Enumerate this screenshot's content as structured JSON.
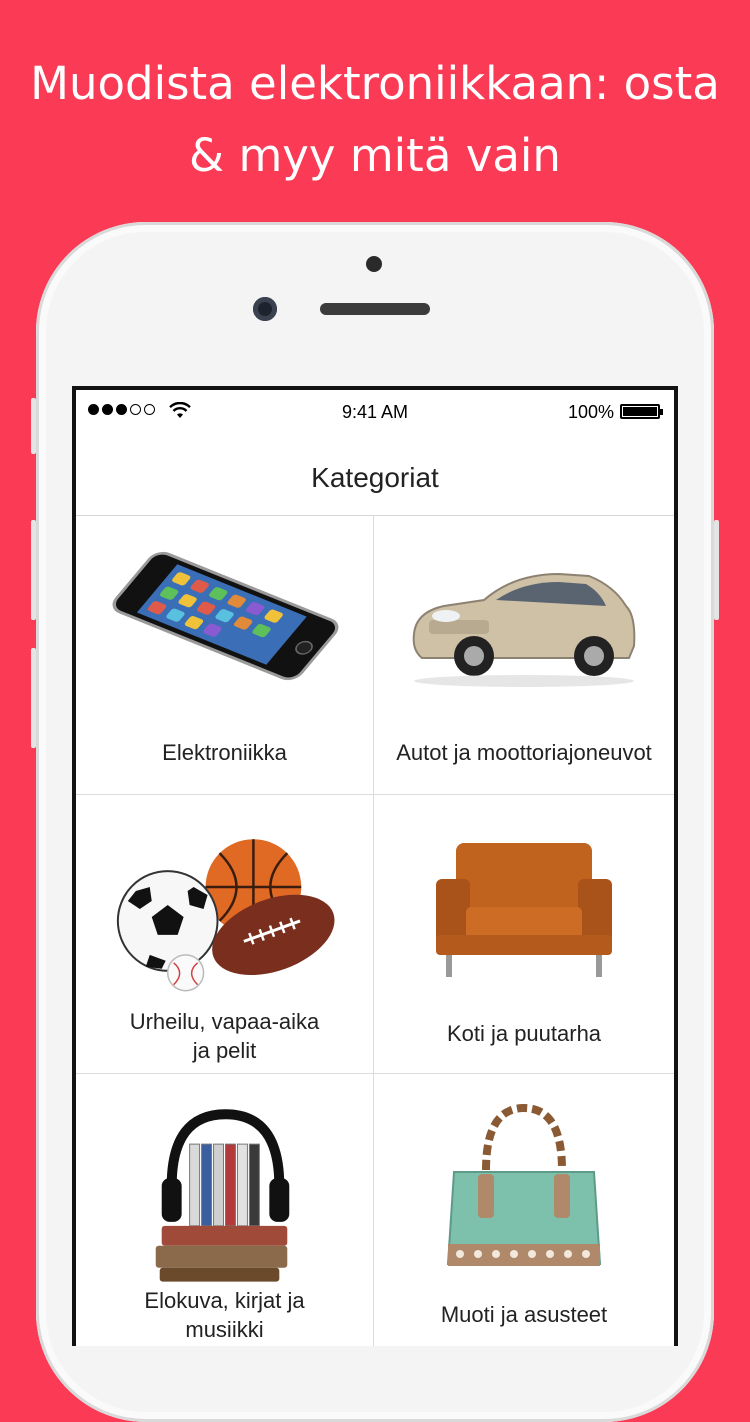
{
  "headline": {
    "line1": "Muodista elektroniikkaan: osta",
    "line2": "& myy mitä vain"
  },
  "status_bar": {
    "time": "9:41 AM",
    "battery": "100%",
    "signal_dots_filled": 3,
    "signal_dots_total": 5
  },
  "nav": {
    "title": "Kategoriat"
  },
  "categories": [
    {
      "label": "Elektroniikka",
      "icon": "smartphone-icon"
    },
    {
      "label": "Autot ja moottoriajoneuvot",
      "icon": "car-icon"
    },
    {
      "label_line1": "Urheilu, vapaa-aika",
      "label_line2": "ja pelit",
      "icon": "sports-balls-icon"
    },
    {
      "label": "Koti ja puutarha",
      "icon": "armchair-icon"
    },
    {
      "label_line1": "Elokuva, kirjat ja",
      "label_line2": "musiikki",
      "icon": "headphones-books-icon"
    },
    {
      "label": "Muoti ja asusteet",
      "icon": "handbag-icon"
    }
  ],
  "colors": {
    "background": "#FB3A55",
    "headline_text": "#FFFFFF"
  }
}
